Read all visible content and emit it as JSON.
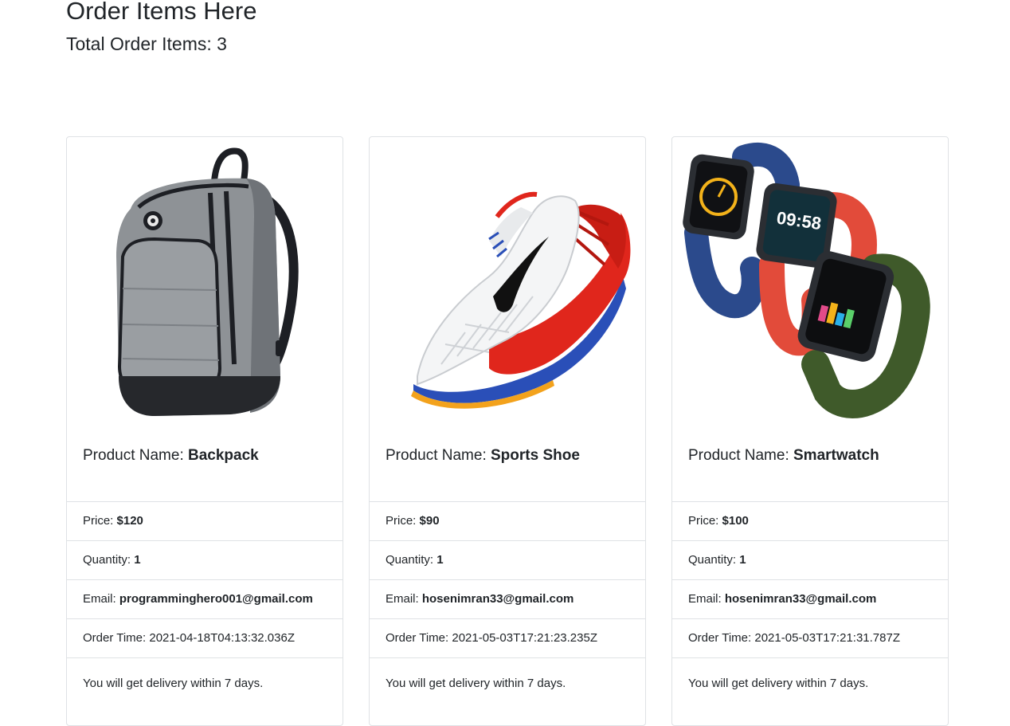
{
  "header": {
    "title": "Order Items Here",
    "total_label": "Total Order Items: 3"
  },
  "labels": {
    "product_name": "Product Name: ",
    "price": "Price: ",
    "quantity": "Quantity: ",
    "email": "Email: ",
    "order_time": "Order Time: "
  },
  "orders": [
    {
      "image": "backpack-image",
      "name": "Backpack",
      "price": "$120",
      "quantity": "1",
      "email": "programminghero001@gmail.com",
      "order_time": "2021-04-18T04:13:32.036Z",
      "delivery": "You will get delivery within 7 days."
    },
    {
      "image": "sports-shoe-image",
      "name": "Sports Shoe",
      "price": "$90",
      "quantity": "1",
      "email": "hosenimran33@gmail.com",
      "order_time": "2021-05-03T17:21:23.235Z",
      "delivery": "You will get delivery within 7 days."
    },
    {
      "image": "smartwatch-image",
      "name": "Smartwatch",
      "price": "$100",
      "quantity": "1",
      "email": "hosenimran33@gmail.com",
      "order_time": "2021-05-03T17:21:31.787Z",
      "delivery": "You will get delivery within 7 days.",
      "watch_display": "09:58"
    }
  ],
  "colors": {
    "text": "#212529",
    "border": "#dfe2e5",
    "backpack_grey": "#8e9296",
    "shoe_red": "#e0261c",
    "watch_blue": "#2b4a8c",
    "watch_red": "#e24b3a",
    "watch_green": "#3f5a2a"
  }
}
